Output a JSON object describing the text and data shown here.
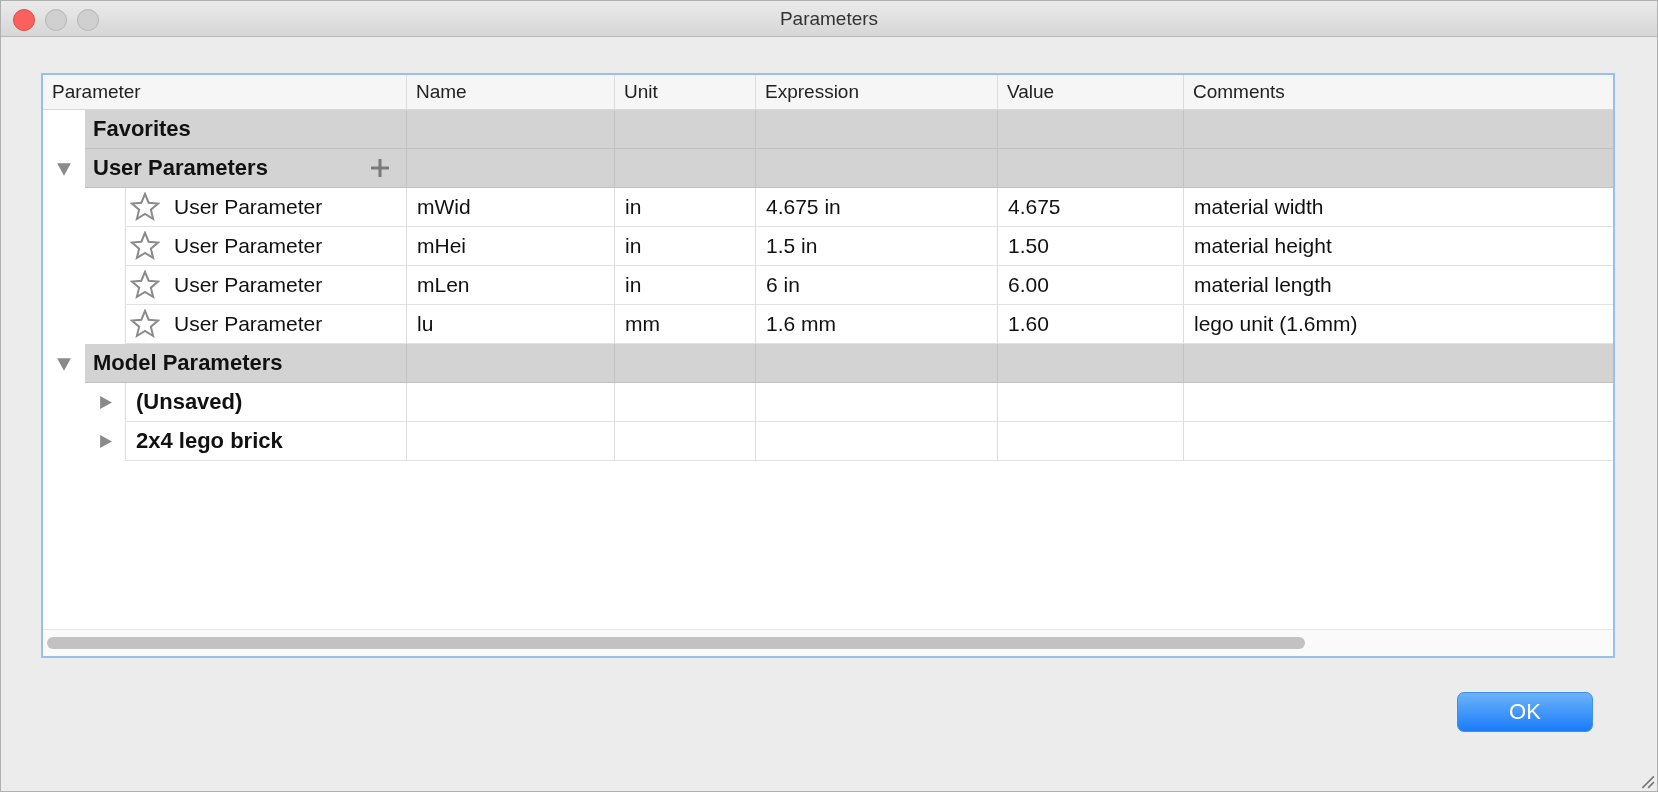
{
  "window": {
    "title": "Parameters"
  },
  "table": {
    "columns": [
      "Parameter",
      "Name",
      "Unit",
      "Expression",
      "Value",
      "Comments"
    ],
    "groups": [
      {
        "label": "Favorites"
      },
      {
        "label": "User Parameters",
        "expanded": true,
        "can_add": true,
        "children": [
          {
            "kind": "parameter",
            "favorite": false,
            "parameter": "User Parameter",
            "name": "mWid",
            "unit": "in",
            "expression": "4.675 in",
            "value": "4.675",
            "comments": "material width"
          },
          {
            "kind": "parameter",
            "favorite": false,
            "parameter": "User Parameter",
            "name": "mHei",
            "unit": "in",
            "expression": "1.5 in",
            "value": "1.50",
            "comments": "material height"
          },
          {
            "kind": "parameter",
            "favorite": false,
            "parameter": "User Parameter",
            "name": "mLen",
            "unit": "in",
            "expression": "6 in",
            "value": "6.00",
            "comments": "material length"
          },
          {
            "kind": "parameter",
            "favorite": false,
            "parameter": "User Parameter",
            "name": "lu",
            "unit": "mm",
            "expression": "1.6 mm",
            "value": "1.60",
            "comments": "lego unit (1.6mm)"
          }
        ]
      },
      {
        "label": "Model Parameters",
        "expanded": true,
        "children": [
          {
            "kind": "model",
            "label": "(Unsaved)",
            "expanded": false
          },
          {
            "kind": "model",
            "label": "2x4 lego brick",
            "expanded": false
          }
        ]
      }
    ]
  },
  "buttons": [
    {
      "label": "OK",
      "default": true
    }
  ]
}
